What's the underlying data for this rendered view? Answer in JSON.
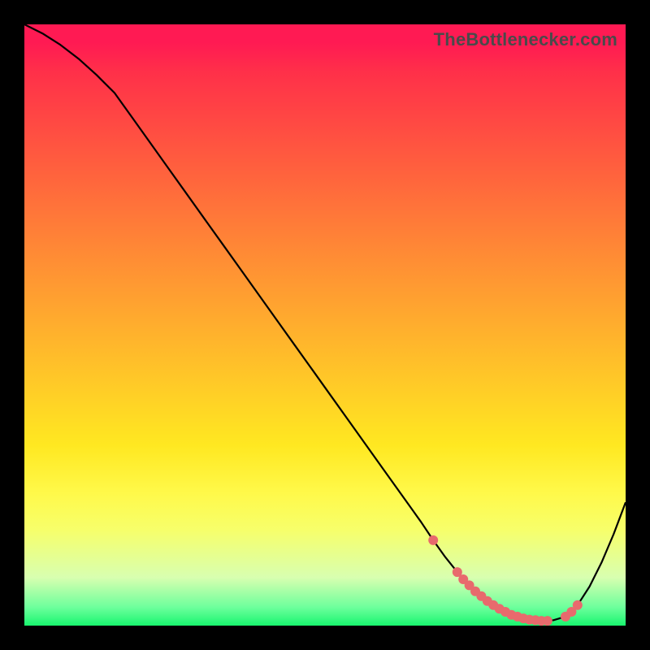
{
  "attribution": "TheBottlenecker.com",
  "colors": {
    "marker": "#e86a6d",
    "line": "#000000"
  },
  "chart_data": {
    "type": "line",
    "title": "",
    "xlabel": "",
    "ylabel": "",
    "xlim": [
      0,
      100
    ],
    "ylim": [
      0,
      100
    ],
    "grid": false,
    "series": [
      {
        "name": "curve",
        "x": [
          0,
          3,
          6,
          9,
          12,
          15,
          18,
          21,
          24,
          27,
          30,
          33,
          36,
          39,
          42,
          45,
          48,
          51,
          54,
          57,
          60,
          63,
          66,
          68,
          70,
          72,
          74,
          76,
          78,
          80,
          82,
          84,
          86,
          88,
          90,
          92,
          94,
          96,
          98,
          100
        ],
        "y": [
          100,
          98.5,
          96.6,
          94.3,
          91.6,
          88.6,
          84.4,
          80.2,
          76.0,
          71.8,
          67.6,
          63.4,
          59.2,
          55.0,
          50.8,
          46.6,
          42.4,
          38.2,
          34.0,
          29.8,
          25.6,
          21.4,
          17.2,
          14.2,
          11.4,
          8.9,
          6.7,
          4.9,
          3.4,
          2.3,
          1.5,
          1.0,
          0.8,
          0.9,
          1.5,
          3.4,
          6.5,
          10.5,
          15.2,
          20.5
        ]
      }
    ],
    "markers": {
      "name": "highlight-points",
      "x": [
        68,
        72,
        73,
        74,
        75,
        76,
        77,
        78,
        79,
        80,
        81,
        82,
        83,
        84,
        85,
        86,
        87,
        90,
        91,
        92
      ],
      "y": [
        14.2,
        8.9,
        7.7,
        6.7,
        5.7,
        4.9,
        4.1,
        3.4,
        2.8,
        2.3,
        1.8,
        1.5,
        1.2,
        1.0,
        0.9,
        0.8,
        0.8,
        1.5,
        2.3,
        3.4
      ]
    }
  }
}
